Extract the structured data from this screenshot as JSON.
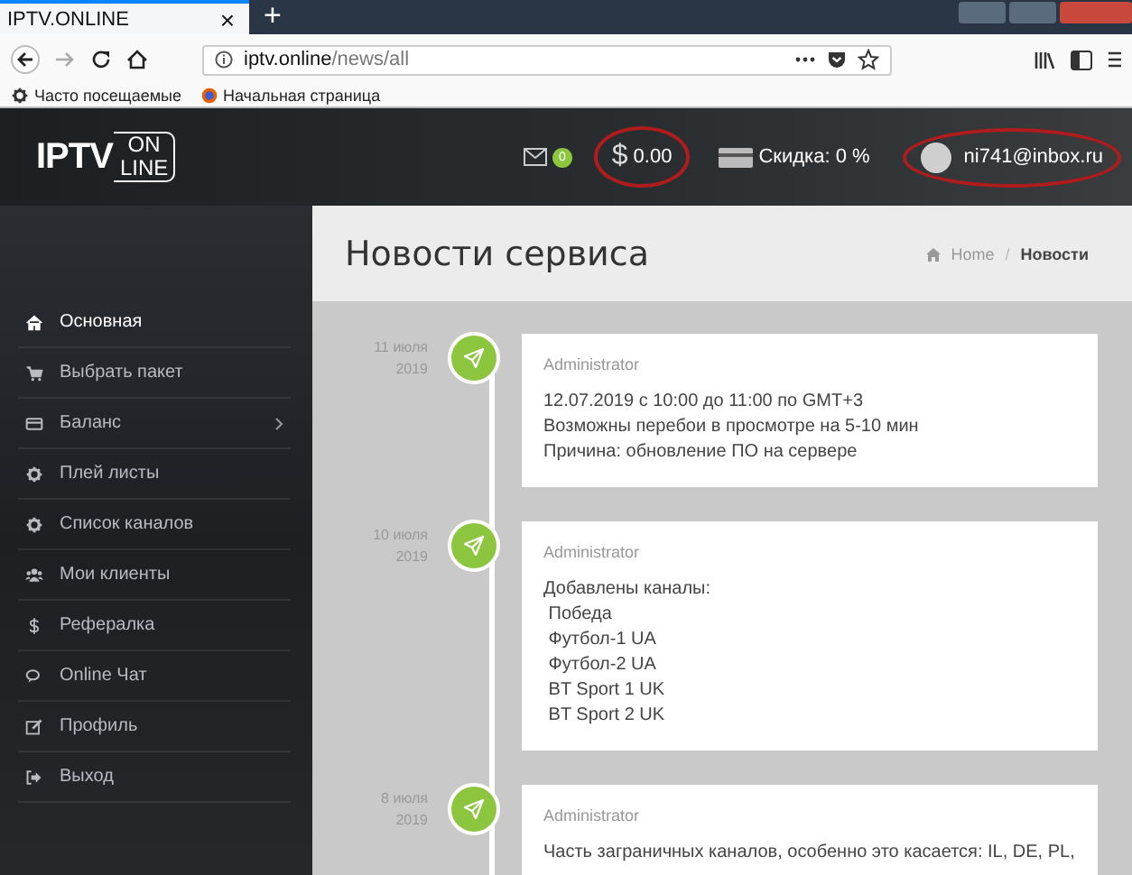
{
  "browser": {
    "tab_title": "IPTV.ONLINE",
    "tab_close": "×",
    "new_tab": "+",
    "url_host": "iptv.online",
    "url_path": "/news/all",
    "bookmarks": [
      {
        "label": "Часто посещаемые",
        "kind": "gear"
      },
      {
        "label": "Начальная страница",
        "kind": "globe"
      }
    ]
  },
  "header": {
    "logo_left": "IPTV",
    "logo_top": "ON",
    "logo_bottom": "LINE",
    "messages_count": "0",
    "balance_currency": "$",
    "balance": "0.00",
    "balance_circled": true,
    "discount": "Скидка: 0 %",
    "user": "ni741@inbox.ru",
    "user_circled": true
  },
  "sidebar": {
    "items": [
      {
        "label": "Основная",
        "kind": "home",
        "selected": true,
        "submenu": false
      },
      {
        "label": "Выбрать пакет",
        "kind": "cart",
        "selected": false,
        "submenu": false
      },
      {
        "label": "Баланс",
        "kind": "card",
        "selected": false,
        "submenu": true
      },
      {
        "label": "Плей листы",
        "kind": "gear",
        "selected": false,
        "submenu": false
      },
      {
        "label": "Список каналов",
        "kind": "gear",
        "selected": false,
        "submenu": false
      },
      {
        "label": "Мои клиенты",
        "kind": "users",
        "selected": false,
        "submenu": false
      },
      {
        "label": "Рефералка",
        "kind": "dollar",
        "selected": false,
        "submenu": false
      },
      {
        "label": "Online Чат",
        "kind": "chat",
        "selected": false,
        "submenu": false
      },
      {
        "label": "Профиль",
        "kind": "edit",
        "selected": false,
        "submenu": false
      },
      {
        "label": "Выход",
        "kind": "logout",
        "selected": false,
        "submenu": false
      }
    ]
  },
  "page": {
    "title": "Новости сервиса",
    "breadcrumb_separator": "/",
    "breadcrumb": [
      {
        "label": "Home",
        "selected": false
      },
      {
        "label": "Новости",
        "selected": true
      }
    ]
  },
  "posts": [
    {
      "day": "11 июля",
      "year": "2019",
      "author": "Administrator",
      "lines": [
        "12.07.2019 с 10:00 до 11:00 по GMT+3",
        "Возможны перебои в просмотре на 5-10 мин",
        "Причина: обновление ПО на сервере"
      ]
    },
    {
      "day": "10 июля",
      "year": "2019",
      "author": "Administrator",
      "lines": [
        "Добавлены каналы:",
        " Победа",
        " Футбол-1 UA",
        " Футбол-2 UA",
        " BT Sport 1 UK",
        " BT Sport 2 UK"
      ]
    },
    {
      "day": "8 июля",
      "year": "2019",
      "author": "Administrator",
      "lines": [
        "Часть заграничных каналов, особенно это касается: IL, DE, PL,"
      ]
    }
  ]
}
